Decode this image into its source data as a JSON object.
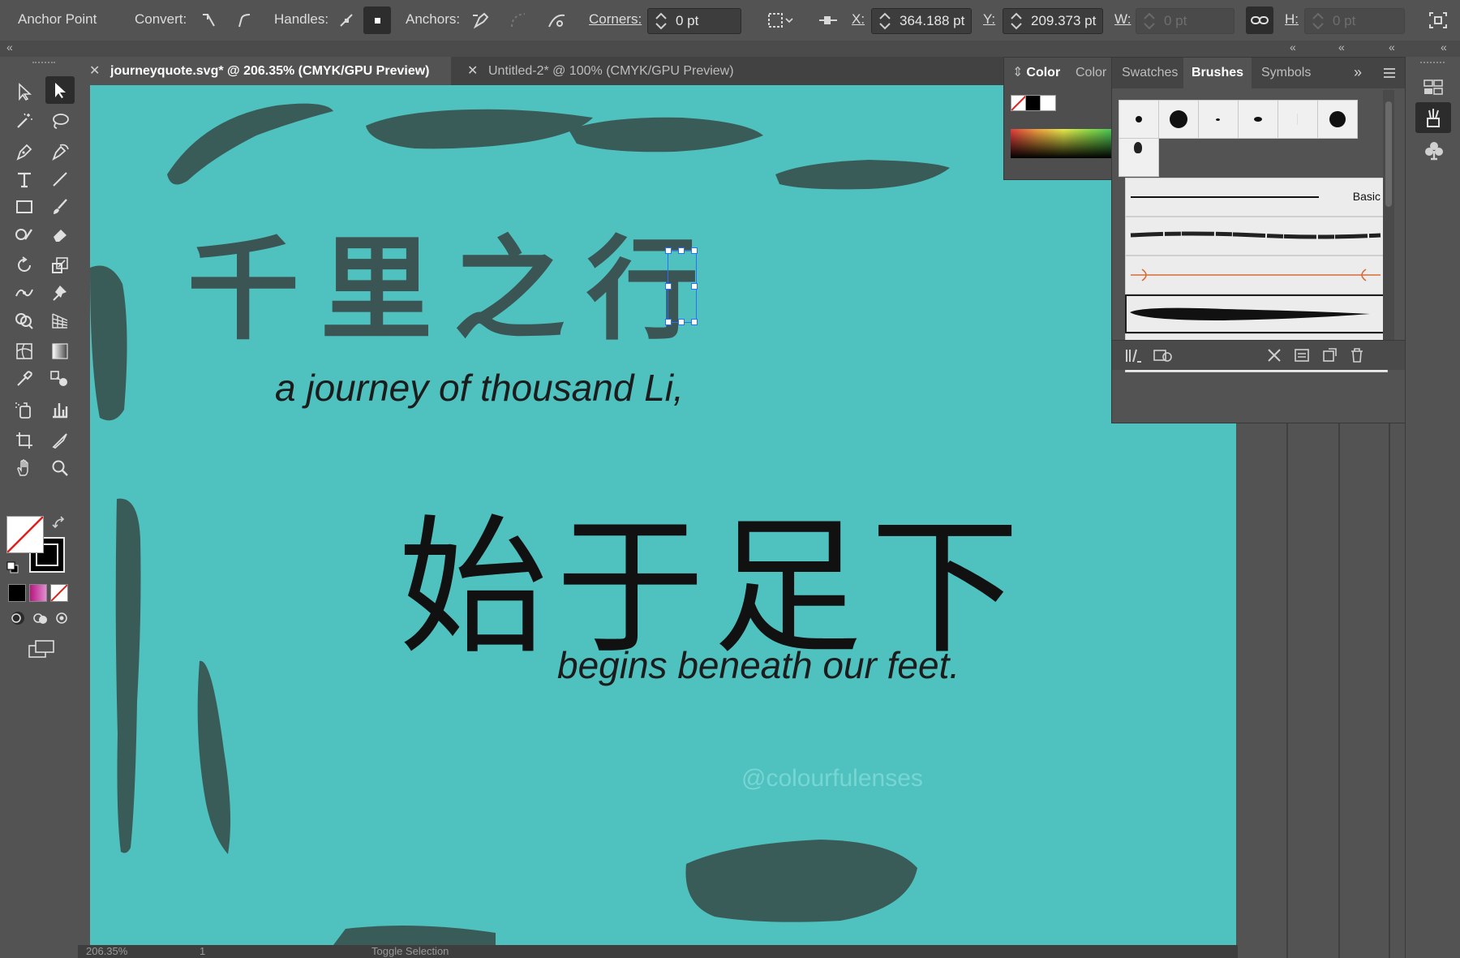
{
  "control_bar": {
    "mode_label": "Anchor Point",
    "convert_label": "Convert:",
    "handles_label": "Handles:",
    "anchors_label": "Anchors:",
    "corners_label": "Corners:",
    "corners_value": "0 pt",
    "x_label": "X:",
    "x_value": "364.188 pt",
    "y_label": "Y:",
    "y_value": "209.373 pt",
    "w_label": "W:",
    "w_value": "0 pt",
    "h_label": "H:",
    "h_value": "0 pt"
  },
  "tabs": [
    {
      "label": "journeyquote.svg* @ 206.35% (CMYK/GPU Preview)",
      "active": true
    },
    {
      "label": "Untitled-2* @ 100% (CMYK/GPU Preview)",
      "active": false
    }
  ],
  "artboard": {
    "background_color": "#4fc1bf",
    "brush_color": "#3a5c58",
    "chinese_line_1": "千里之行",
    "english_line_1": "a journey of thousand Li,",
    "chinese_line_2": "始于足下",
    "english_line_2": "begins beneath our feet.",
    "handle": "@colourfulenses"
  },
  "color_panel": {
    "tab_color": "Color",
    "tab_color_guide": "Color"
  },
  "brushes_panel": {
    "tabs": [
      "Swatches",
      "Brushes",
      "Symbols"
    ],
    "active_tab": "Brushes",
    "basic_label": "Basic"
  },
  "status_bar": {
    "zoom": "206.35%",
    "page": "1",
    "tool": "Toggle Selection"
  },
  "icons": [
    "selection-icon",
    "direct-selection-icon",
    "magic-wand-icon",
    "lasso-icon",
    "pen-icon",
    "curvature-icon",
    "type-icon",
    "line-icon",
    "rectangle-icon",
    "paintbrush-icon",
    "shaper-icon",
    "eraser-icon",
    "rotate-icon",
    "scale-icon",
    "width-icon",
    "puppet-warp-icon",
    "shape-builder-icon",
    "perspective-grid-icon",
    "mesh-icon",
    "gradient-icon",
    "eyedropper-icon",
    "blend-icon",
    "symbol-sprayer-icon",
    "column-graph-icon",
    "artboard-icon",
    "slice-icon",
    "hand-icon",
    "zoom-icon"
  ]
}
